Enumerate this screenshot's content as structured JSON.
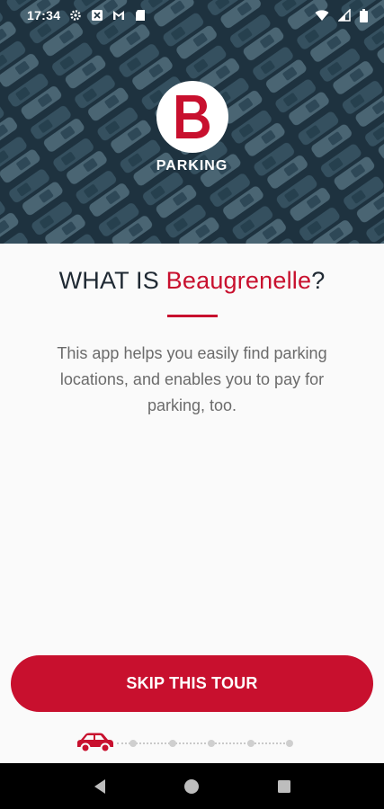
{
  "status_bar": {
    "time": "17:34",
    "icons_left": [
      "gear-icon",
      "box-icon",
      "gmail-icon",
      "sd-card-icon"
    ],
    "icons_right": [
      "wifi-icon",
      "signal-icon",
      "battery-icon"
    ]
  },
  "hero": {
    "logo_letter": "B",
    "logo_text": "PARKING"
  },
  "intro": {
    "title_prefix": "WHAT IS ",
    "title_brand": "Beaugrenelle",
    "title_suffix": "?",
    "description": "This app helps you easily find parking locations, and enables you to pay for parking, too."
  },
  "actions": {
    "skip_label": "SKIP THIS TOUR"
  },
  "pager": {
    "current_page": 1,
    "total_pages": 6,
    "current_indicator_icon": "car-icon"
  },
  "colors": {
    "accent": "#c8102e",
    "hero_bg": "#1e323f",
    "text_dark": "#1f2933",
    "text_muted": "#6b6b6b"
  },
  "nav_bar": {
    "buttons": [
      "back-icon",
      "home-icon",
      "recents-icon"
    ]
  }
}
